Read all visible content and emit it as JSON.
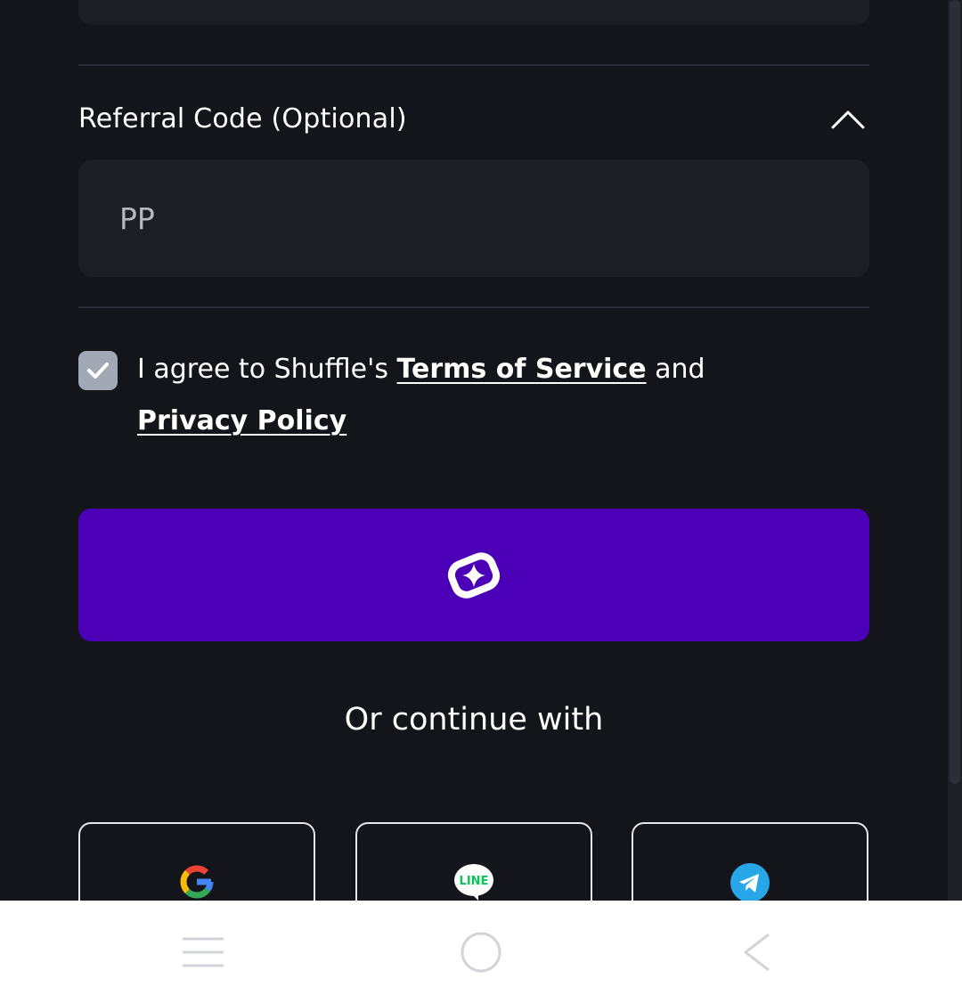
{
  "referral": {
    "title": "Referral Code (Optional)",
    "value": "PP"
  },
  "agreement": {
    "prefix": "I agree to Shuffle's",
    "terms_link": "Terms of Service",
    "conjunction": "and",
    "privacy_link": "Privacy Policy",
    "checked": true
  },
  "submit": {
    "icon": "shuffle-logo-icon"
  },
  "social": {
    "heading": "Or continue with",
    "providers": [
      {
        "name": "google",
        "icon": "google-icon"
      },
      {
        "name": "line",
        "icon": "line-icon",
        "label": "LINE"
      },
      {
        "name": "telegram",
        "icon": "telegram-icon"
      }
    ]
  },
  "colors": {
    "background": "#14151a",
    "field": "#1c1e24",
    "accent": "#4b00b8",
    "checkbox": "#a3a8b5",
    "line_green": "#06c755",
    "telegram_blue": "#27a7e7"
  },
  "system_nav": {
    "buttons": [
      "menu-icon",
      "home-icon",
      "back-icon"
    ]
  }
}
